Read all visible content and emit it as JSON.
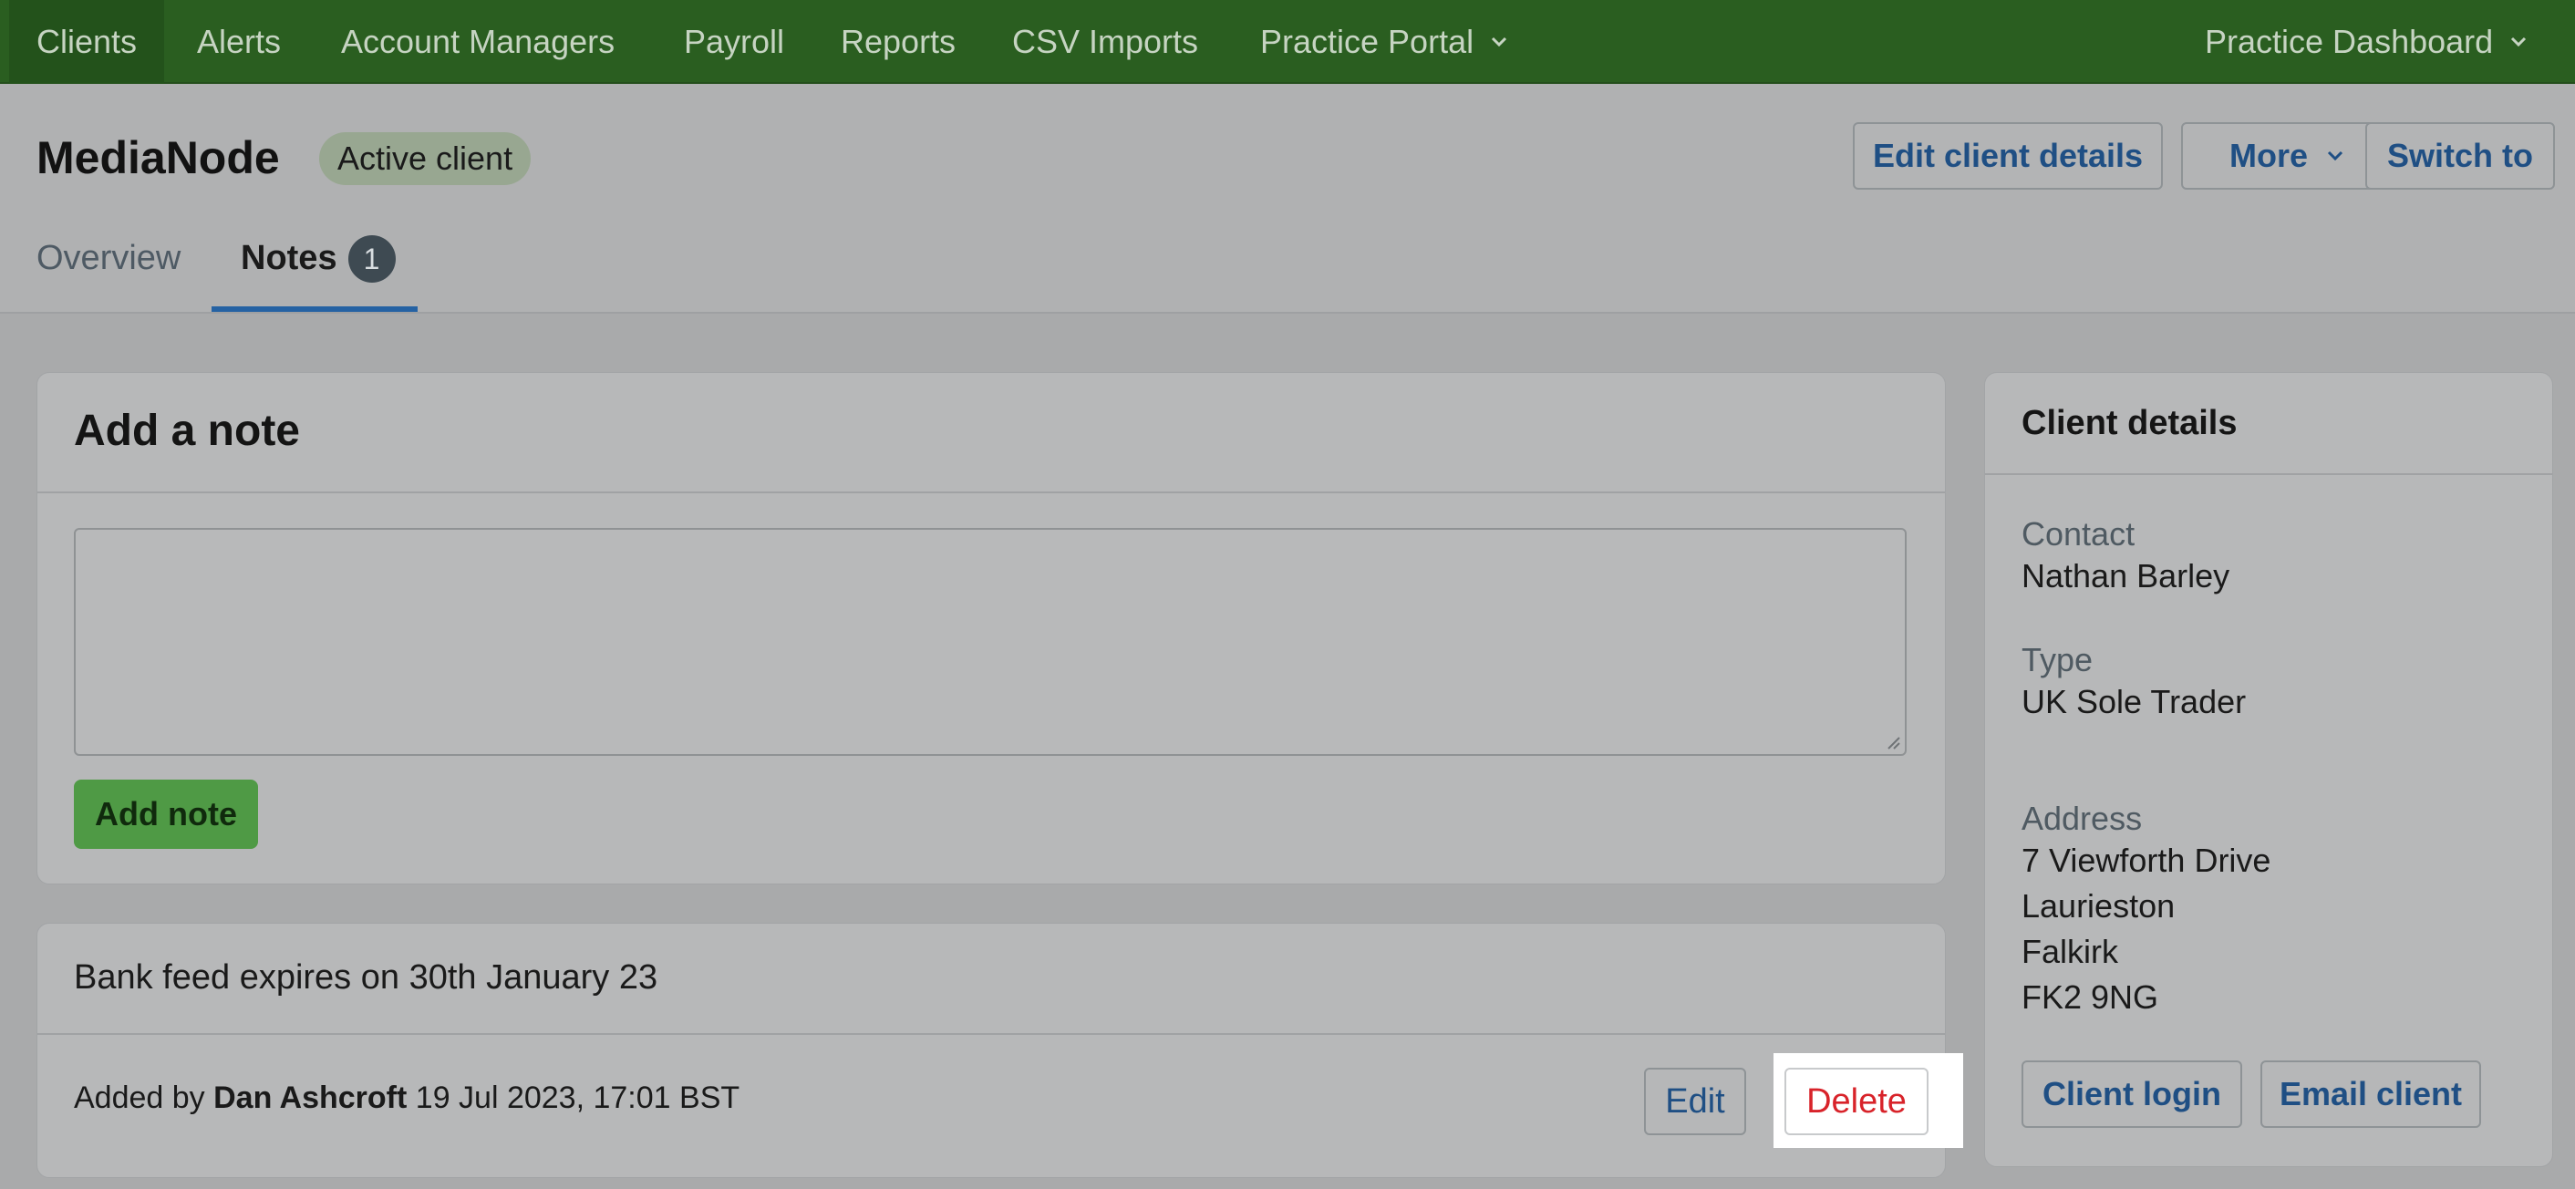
{
  "nav": {
    "items": [
      {
        "label": "Clients"
      },
      {
        "label": "Alerts"
      },
      {
        "label": "Account Managers"
      },
      {
        "label": "Payroll"
      },
      {
        "label": "Reports"
      },
      {
        "label": "CSV Imports"
      },
      {
        "label": "Practice Portal"
      }
    ],
    "right_label": "Practice Dashboard"
  },
  "client": {
    "name": "MediaNode",
    "status": "Active client"
  },
  "header_actions": {
    "edit_label": "Edit client details",
    "more_label": "More",
    "switch_label": "Switch to"
  },
  "tabs": {
    "overview": "Overview",
    "notes": "Notes",
    "notes_count": "1"
  },
  "add_note": {
    "title": "Add a note",
    "textarea_value": "",
    "button_label": "Add note"
  },
  "note": {
    "text": "Bank feed expires on 30th January 23",
    "added_by_prefix": "Added by",
    "author": "Dan Ashcroft",
    "timestamp": "19 Jul 2023, 17:01 BST",
    "edit_label": "Edit",
    "delete_label": "Delete"
  },
  "client_details": {
    "title": "Client details",
    "contact_label": "Contact",
    "contact_value": "Nathan Barley",
    "type_label": "Type",
    "type_value": "UK Sole Trader",
    "address_label": "Address",
    "address_lines": [
      "7 Viewforth Drive",
      "Laurieston",
      "Falkirk",
      "FK2 9NG"
    ],
    "login_label": "Client login",
    "email_label": "Email client"
  },
  "colors": {
    "nav_bg": "#2a5e20",
    "link_blue": "#1f4f84",
    "delete_red": "#d8232a",
    "add_note_green": "#4f9a45"
  }
}
